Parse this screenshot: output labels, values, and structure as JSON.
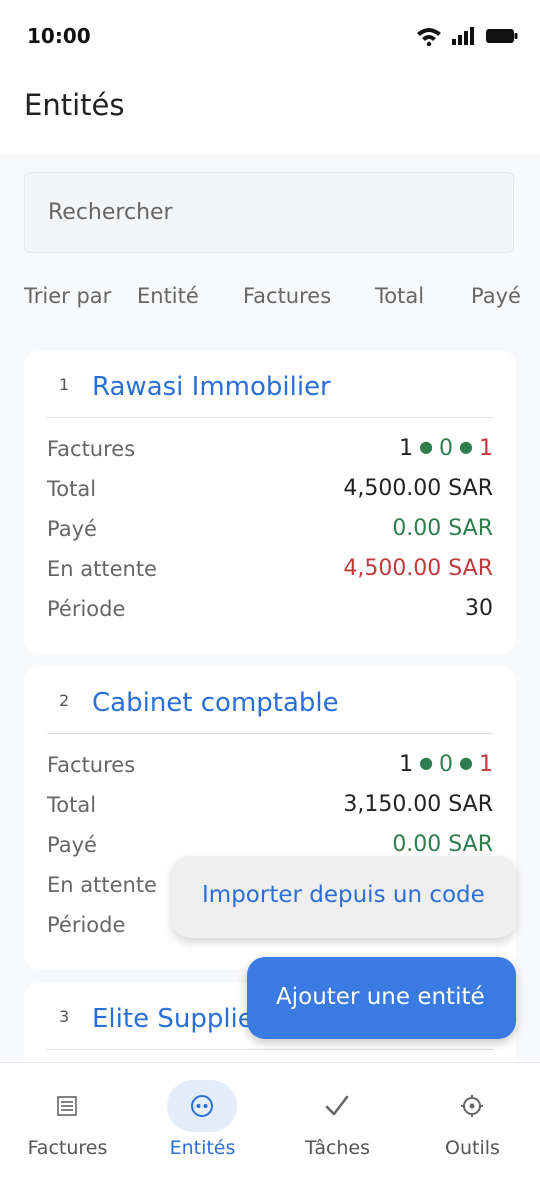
{
  "status_bar": {
    "time": "10:00"
  },
  "header": {
    "title": "Entités"
  },
  "search": {
    "placeholder": "Rechercher"
  },
  "sort": {
    "label": "Trier par",
    "options": [
      "Entité",
      "Factures",
      "Total",
      "Payé"
    ]
  },
  "entities": [
    {
      "index": "1",
      "name": "Rawasi Immobilier",
      "rows": {
        "factures_label": "Factures",
        "factures_a": "1",
        "factures_b": "0",
        "factures_c": "1",
        "total_label": "Total",
        "total": "4,500.00 SAR",
        "paye_label": "Payé",
        "paye": "0.00 SAR",
        "attente_label": "En attente",
        "attente": "4,500.00 SAR",
        "periode_label": "Période",
        "periode": "30"
      }
    },
    {
      "index": "2",
      "name": "Cabinet comptable",
      "rows": {
        "factures_label": "Factures",
        "factures_a": "1",
        "factures_b": "0",
        "factures_c": "1",
        "total_label": "Total",
        "total": "3,150.00 SAR",
        "paye_label": "Payé",
        "paye": "0.00 SAR",
        "attente_label": "En attente",
        "periode_label": "Période"
      }
    },
    {
      "index": "3",
      "name": "Elite Supplie"
    }
  ],
  "fab": {
    "import_label": "Importer depuis un code",
    "add_label": "Ajouter une entité"
  },
  "bottom_nav": [
    {
      "label": "Factures",
      "icon": "list-icon"
    },
    {
      "label": "Entités",
      "icon": "entities-icon",
      "active": true
    },
    {
      "label": "Tâches",
      "icon": "check-icon"
    },
    {
      "label": "Outils",
      "icon": "gear-icon"
    }
  ],
  "colors": {
    "accent": "#2b6fd6",
    "fab": "#3a7be3",
    "positive": "#2e7d4f",
    "negative": "#c0393b"
  }
}
